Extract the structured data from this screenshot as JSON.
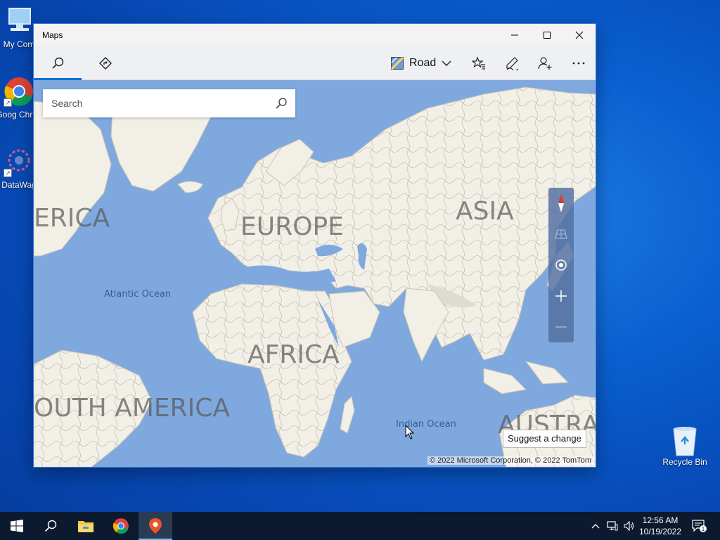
{
  "desktop": {
    "icons": [
      {
        "label": "My Com"
      },
      {
        "label": "Goog Chron"
      },
      {
        "label": "DataWag"
      },
      {
        "label": "Recycle Bin"
      }
    ]
  },
  "window": {
    "title": "Maps"
  },
  "appbar": {
    "map_style": "Road"
  },
  "map": {
    "search_placeholder": "Search",
    "labels": {
      "north_america": "ERICA",
      "europe": "EUROPE",
      "asia": "ASIA",
      "africa": "AFRICA",
      "south_america": "OUTH AMERICA",
      "australia": "AUSTRA",
      "atlantic": "Atlantic Ocean",
      "indian": "Indian Ocean"
    },
    "suggest_change": "Suggest a change",
    "copyright": "© 2022 Microsoft Corporation, © 2022 TomTom"
  },
  "taskbar": {
    "time": "12:56 AM",
    "date": "10/19/2022",
    "notification_count": "1"
  },
  "colors": {
    "accent": "#0b6fd6",
    "water": "#7fa9de",
    "land": "#f2efe6",
    "taskbar": "#0b1a2e"
  }
}
